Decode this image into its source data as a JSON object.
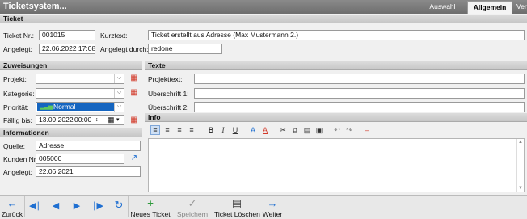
{
  "app": {
    "title": "Ticketsystem..."
  },
  "tabs": [
    {
      "label": "Auswahl"
    },
    {
      "label": "Allgemein",
      "active": true
    },
    {
      "label": "Verlauf"
    }
  ],
  "ticket": {
    "section_title": "Ticket",
    "nr_label": "Ticket Nr.:",
    "nr_value": "001015",
    "kurztext_label": "Kurztext:",
    "kurztext_value": "Ticket erstellt aus Adresse (Max Mustermann 2.)",
    "angelegt_label": "Angelegt:",
    "angelegt_value": "22.06.2022 17:08",
    "durch_label": "Angelegt durch:",
    "durch_value": "redone"
  },
  "zuweisungen": {
    "section_title": "Zuweisungen",
    "projekt_label": "Projekt:",
    "projekt_value": "",
    "kategorie_label": "Kategorie:",
    "kategorie_value": "",
    "prioritaet_label": "Priorität:",
    "prioritaet_value": "Normal",
    "faellig_label": "Fällig bis:",
    "faellig_date": "13.09.2022",
    "faellig_time": "00:00"
  },
  "informationen": {
    "section_title": "Informationen",
    "quelle_label": "Quelle:",
    "quelle_value": "Adresse",
    "kunden_label": "Kunden Nr.:",
    "kunden_value": "005000",
    "angelegt_label": "Angelegt:",
    "angelegt_value": "22.06.2021"
  },
  "texte": {
    "section_title": "Texte",
    "projekttext_label": "Projekttext:",
    "projekttext_value": "",
    "ueberschrift1_label": "Überschrift 1:",
    "ueberschrift1_value": "",
    "ueberschrift2_label": "Überschrift 2:",
    "ueberschrift2_value": ""
  },
  "info": {
    "section_title": "Info",
    "content": ""
  },
  "bottom": {
    "back": "Zurück",
    "new_ticket": "Neues Ticket",
    "save": "Speichern",
    "delete_ticket": "Ticket Löschen",
    "next": "Weiter"
  },
  "colors": {
    "accent_blue": "#1f6fd1",
    "green_add": "#2e9a3c",
    "red_delete": "#d23a2a",
    "priority_bg": "#1565c0"
  }
}
